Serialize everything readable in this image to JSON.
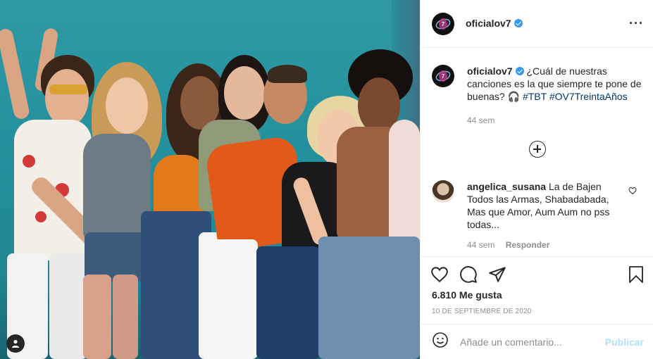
{
  "post": {
    "username": "oficialov7",
    "caption_text": "¿Cuál de nuestras canciones es la que siempre te pone de buenas? 🎧",
    "hashtags": [
      "#TBT",
      "#OV7TreintaAños"
    ],
    "caption_time": "44 sem",
    "likes": "6.810 Me gusta",
    "date": "10 DE SEPTIEMBRE DE 2020"
  },
  "comment": {
    "username": "angelica_susana",
    "text": "La de Bajen Todos las Armas, Shabadabada, Mas que Amor, Aum Aum no pss todas...",
    "time": "44 sem",
    "reply_label": "Responder"
  },
  "add_comment": {
    "placeholder": "Añade un comentario...",
    "publish_label": "Publicar"
  },
  "icons": {
    "more": "more-options-icon",
    "load_more": "plus-circle-icon",
    "like": "heart-icon",
    "comment": "comment-icon",
    "share": "paper-plane-icon",
    "save": "bookmark-icon",
    "emoji": "emoji-icon",
    "user_tags": "user-tag-icon"
  },
  "colors": {
    "verified": "#3897f0",
    "hashtag": "#00376b",
    "publish_disabled": "#b2dffc",
    "secondary_text": "#8e8e8e"
  }
}
